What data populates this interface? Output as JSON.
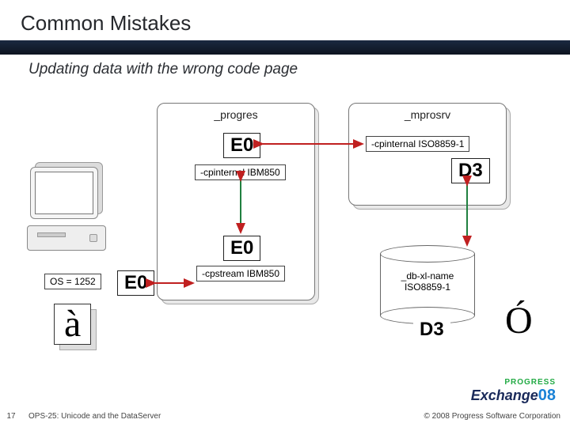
{
  "slide": {
    "title": "Common Mistakes",
    "subtitle": "Updating data with the wrong code page",
    "page_number": "17",
    "footer_title": "OPS-25: Unicode and the DataServer",
    "copyright": "© 2008 Progress Software Corporation"
  },
  "boxes": {
    "client": {
      "title": "_progres",
      "cpinternal": "-cpinternal IBM850",
      "cpstream": "-cpstream IBM850"
    },
    "server": {
      "title": "_mprosrv",
      "cpinternal": "-cpinternal ISO8859-1"
    }
  },
  "codes": {
    "client_internal": "E0",
    "client_stream": "E0",
    "os_out": "E0",
    "server_internal": "D3",
    "db_stored": "D3"
  },
  "os": {
    "label": "OS = 1252"
  },
  "db": {
    "label": "_db-xl-name\nISO8859-1"
  },
  "glyphs": {
    "input": "à",
    "output": "Ó"
  },
  "logo": {
    "brand": "PROGRESS",
    "event": "Exchange",
    "year": "08"
  }
}
